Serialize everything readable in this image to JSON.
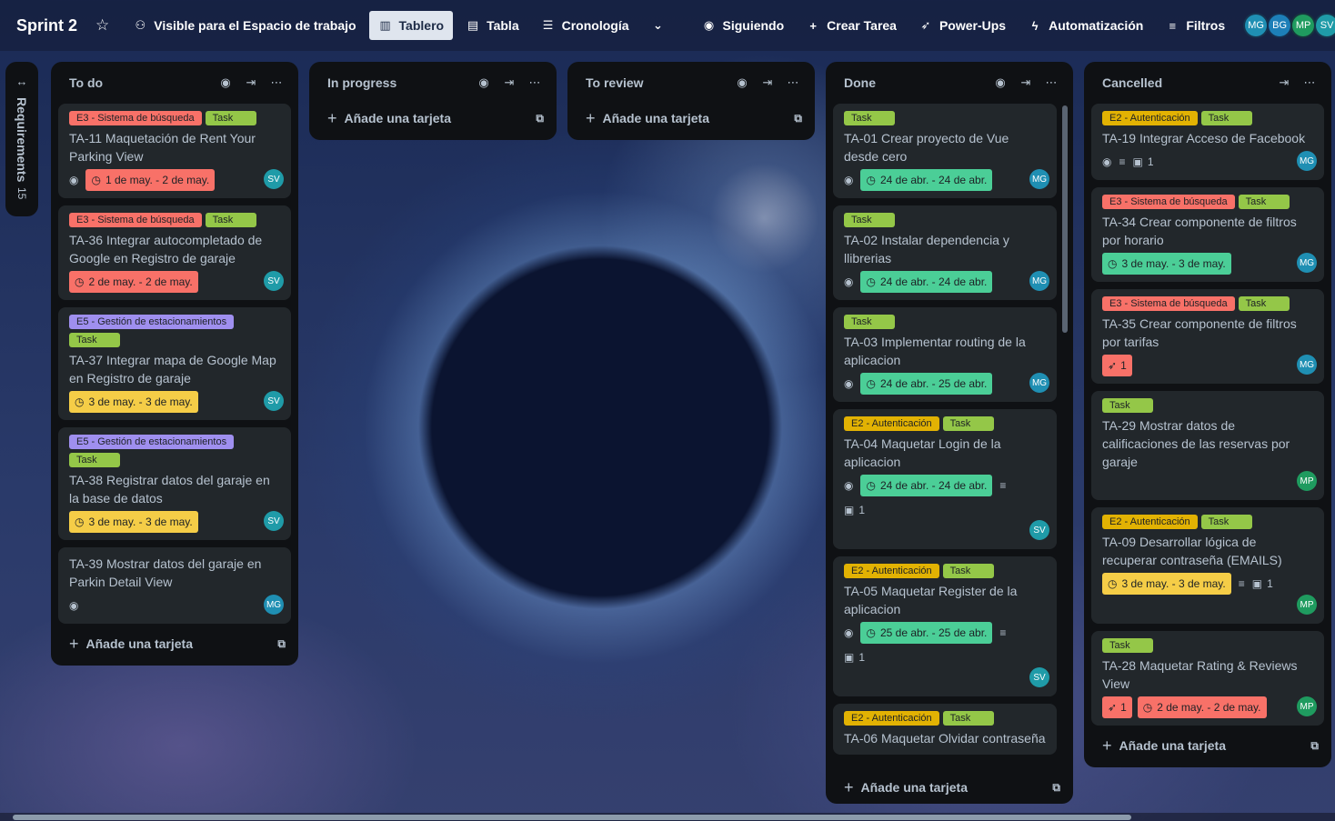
{
  "topbar": {
    "board_title": "Sprint 2",
    "visibility": "Visible para el Espacio de trabajo",
    "views": [
      "Tablero",
      "Tabla",
      "Cronología"
    ],
    "following": "Siguiendo",
    "create_task": "Crear Tarea",
    "power_ups": "Power-Ups",
    "automation": "Automatización",
    "filters": "Filtros",
    "members": [
      "MG",
      "BG",
      "MP",
      "SV"
    ]
  },
  "collapsed_list": {
    "title": "Requirements",
    "count": "15"
  },
  "add_card_label": "Añade una tarjeta",
  "lists": [
    {
      "title": "To do",
      "cards": [
        {
          "labels": [
            "E3 - Sistema de búsqueda",
            "Task"
          ],
          "title": "TA-11 Maquetación de Rent Your Parking View",
          "date": "1 de may. - 2 de may.",
          "member": "SV"
        },
        {
          "labels": [
            "E3 - Sistema de búsqueda",
            "Task"
          ],
          "title": "TA-36 Integrar autocompletado de Google en Registro de garaje",
          "date": "2 de may. - 2 de may.",
          "member": "SV"
        },
        {
          "labels": [
            "E5 - Gestión de estacionamientos",
            "Task"
          ],
          "title": "TA-37 Integrar mapa de Google Map en Registro de garaje",
          "date": "3 de may. - 3 de may.",
          "member": "SV"
        },
        {
          "labels": [
            "E5 - Gestión de estacionamientos",
            "Task"
          ],
          "title": "TA-38 Registrar datos del garaje en la base de datos",
          "date": "3 de may. - 3 de may.",
          "member": "SV"
        },
        {
          "labels": [],
          "title": "TA-39 Mostrar datos del garaje en Parkin Detail View",
          "member": "MG"
        }
      ]
    },
    {
      "title": "In progress",
      "cards": []
    },
    {
      "title": "To review",
      "cards": []
    },
    {
      "title": "Done",
      "cards": [
        {
          "labels": [
            "Task"
          ],
          "title": "TA-01 Crear proyecto de Vue desde cero",
          "date": "24 de abr. - 24 de abr.",
          "member": "MG"
        },
        {
          "labels": [
            "Task"
          ],
          "title": "TA-02 Instalar dependencia y llibrerias",
          "date": "24 de abr. - 24 de abr.",
          "member": "MG"
        },
        {
          "labels": [
            "Task"
          ],
          "title": "TA-03 Implementar routing de la aplicacion",
          "date": "24 de abr. - 25 de abr.",
          "member": "MG"
        },
        {
          "labels": [
            "E2 - Autenticación",
            "Task"
          ],
          "title": "TA-04 Maquetar Login de la aplicacion",
          "date": "24 de abr. - 24 de abr.",
          "checklist": "1",
          "member": "SV"
        },
        {
          "labels": [
            "E2 - Autenticación",
            "Task"
          ],
          "title": "TA-05 Maquetar Register de la aplicacion",
          "date": "25 de abr. - 25 de abr.",
          "checklist": "1",
          "member": "SV"
        },
        {
          "labels": [
            "E2 - Autenticación",
            "Task"
          ],
          "title": "TA-06 Maquetar Olvidar contraseña"
        }
      ]
    },
    {
      "title": "Cancelled",
      "cards": [
        {
          "labels": [
            "E2 - Autenticación",
            "Task"
          ],
          "title": "TA-19 Integrar Acceso de Facebook",
          "checklist": "1",
          "member": "MG"
        },
        {
          "labels": [
            "E3 - Sistema de búsqueda",
            "Task"
          ],
          "title": "TA-34 Crear componente de filtros por horario",
          "date": "3 de may. - 3 de may.",
          "member": "MG"
        },
        {
          "labels": [
            "E3 - Sistema de búsqueda",
            "Task"
          ],
          "title": "TA-35 Crear componente de filtros por tarifas",
          "votes": "1",
          "member": "MG"
        },
        {
          "labels": [
            "Task"
          ],
          "title": "TA-29 Mostrar datos de calificaciones de las reservas por garaje",
          "member": "MP"
        },
        {
          "labels": [
            "E2 - Autenticación",
            "Task"
          ],
          "title": "TA-09 Desarrollar lógica de recuperar contraseña (EMAILS)",
          "date": "3 de may. - 3 de may.",
          "checklist": "1",
          "member": "MP"
        },
        {
          "labels": [
            "Task"
          ],
          "title": "TA-28 Maquetar Rating & Reviews View",
          "votes": "1",
          "date": "2 de may. - 2 de may.",
          "member": "MP"
        }
      ]
    }
  ]
}
